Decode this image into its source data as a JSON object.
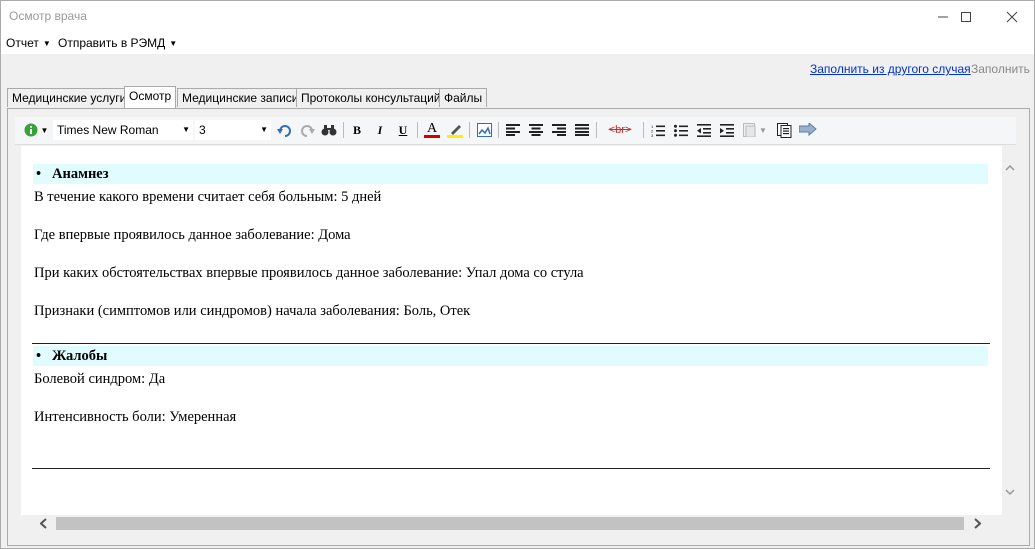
{
  "window": {
    "title": "Осмотр врача",
    "minimize_icon": "minimize-icon",
    "maximize_icon": "maximize-icon",
    "close_icon": "close-icon"
  },
  "menu": {
    "report": "Отчет",
    "send": "Отправить в РЭМД"
  },
  "actions": {
    "fill_from_other": "Заполнить из другого случая",
    "fill": "Заполнить"
  },
  "tabs": [
    {
      "label": "Медицинские услуги"
    },
    {
      "label": "Осмотр",
      "active": true
    },
    {
      "label": "Медицинские записи"
    },
    {
      "label": "Протоколы консультаций"
    },
    {
      "label": "Файлы"
    }
  ],
  "toolbar": {
    "font_family": "Times New Roman",
    "font_size": "3",
    "bold": "B",
    "italic": "I",
    "underline": "U",
    "font_color": "A",
    "br_tag": "<br>",
    "colors": {
      "font": "#d40000",
      "highlight": "#ffee00",
      "info": "#3aa03a"
    }
  },
  "document": {
    "sections": [
      {
        "heading": "Анамнез",
        "lines": [
          "В течение какого времени считает себя больным: 5 дней",
          "Где впервые проявилось данное заболевание: Дома",
          "При каких обстоятельствах впервые проявилось данное заболевание: Упал дома со стула",
          "Признаки (симптомов или синдромов) начала заболевания: Боль, Отек"
        ]
      },
      {
        "heading": "Жалобы",
        "lines": [
          "Болевой синдром: Да",
          "Интенсивность боли: Умеренная"
        ]
      }
    ],
    "bullet": "•",
    "section_bg": "#e0fcff"
  }
}
